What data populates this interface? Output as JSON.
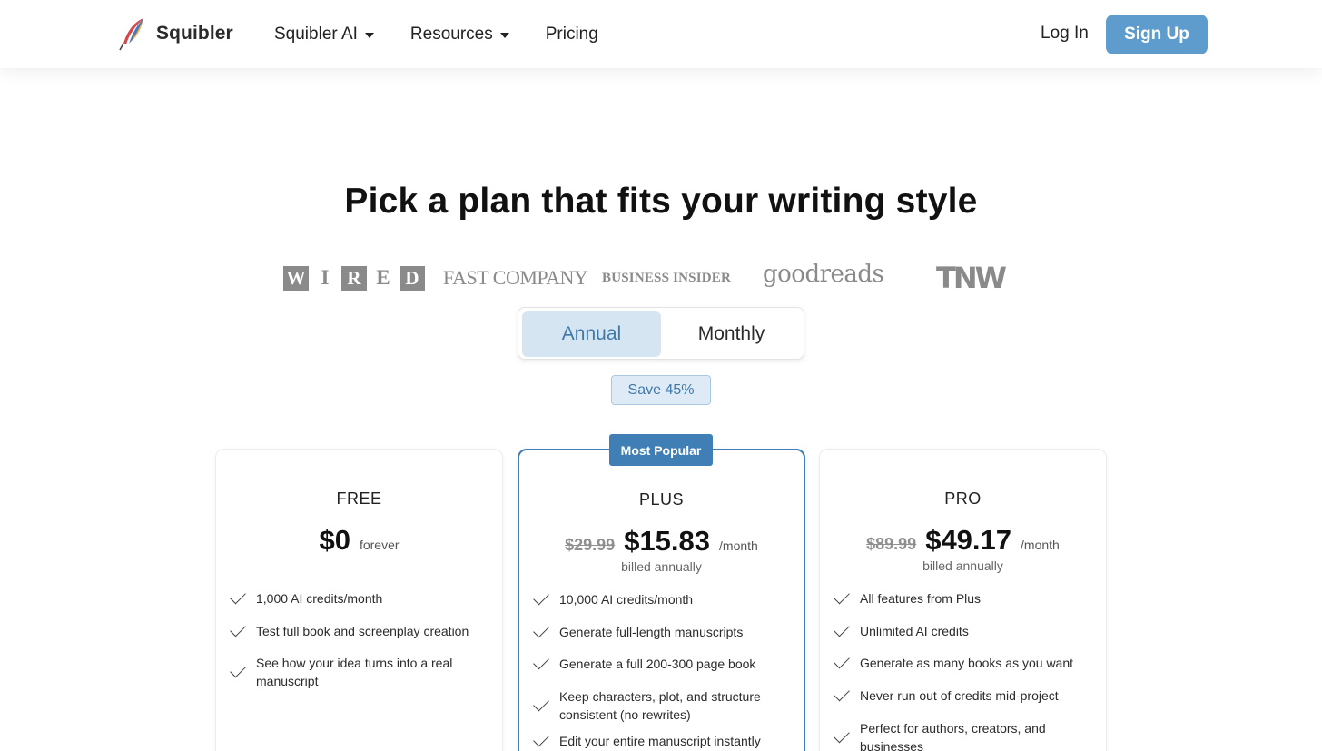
{
  "nav": {
    "brand": "Squibler",
    "links": [
      {
        "label": "Squibler AI",
        "dropdown": true
      },
      {
        "label": "Resources",
        "dropdown": true
      },
      {
        "label": "Pricing",
        "dropdown": false
      }
    ],
    "login": "Log In",
    "signup": "Sign Up"
  },
  "headline": "Pick a plan that fits your writing style",
  "logos": {
    "wired": [
      "W",
      "I",
      "R",
      "E",
      "D"
    ],
    "fastcompany": "FAST COMPANY",
    "businessinsider": "BUSINESS INSIDER",
    "goodreads": "goodreads",
    "tnw": "TNW"
  },
  "billing_toggle": {
    "annual": "Annual",
    "monthly": "Monthly",
    "selected": "Annual"
  },
  "save_badge": "Save 45%",
  "plans": {
    "free": {
      "name": "FREE",
      "price": "$0",
      "unit": "forever",
      "features": [
        "1,000 AI credits/month",
        "Test full book and screenplay creation",
        "See how your idea turns into a real manuscript"
      ]
    },
    "plus": {
      "badge": "Most Popular",
      "name": "PLUS",
      "old_price": "$29.99",
      "price": "$15.83",
      "unit": "/month",
      "billed": "billed annually",
      "features": [
        "10,000 AI credits/month",
        "Generate full-length manuscripts",
        "Generate a full 200-300 page book",
        "Keep characters, plot, and structure consistent (no rewrites)",
        "Edit your entire manuscript instantly"
      ]
    },
    "pro": {
      "name": "PRO",
      "old_price": "$89.99",
      "price": "$49.17",
      "unit": "/month",
      "billed": "billed annually",
      "features": [
        "All features from Plus",
        "Unlimited AI credits",
        "Generate as many books as you want",
        "Never run out of credits mid-project",
        "Perfect for authors, creators, and businesses"
      ]
    }
  },
  "colors": {
    "accent": "#3f7fb6",
    "signup_bg": "#5e9ccd",
    "toggle_selected_bg": "#d6e5f2"
  }
}
